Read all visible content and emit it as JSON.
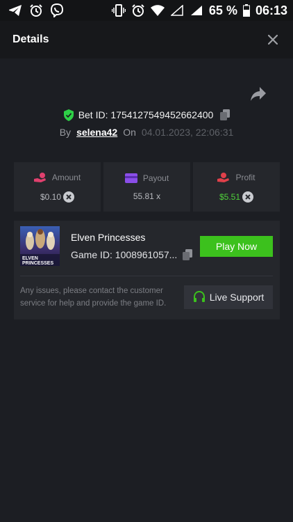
{
  "status_bar": {
    "battery_percent": "65 %",
    "time": "06:13",
    "icons": [
      "telegram-icon",
      "alarm-icon",
      "viber-icon",
      "vibrate-icon",
      "alarm-icon",
      "wifi-icon",
      "signal-icon",
      "signal-icon",
      "battery-icon"
    ]
  },
  "header": {
    "title": "Details"
  },
  "bet": {
    "id_label": "Bet ID: 1754127549452662400",
    "by_label": "By",
    "user": "selena42",
    "on_label": "On",
    "date": "04.01.2023, 22:06:31"
  },
  "stats": [
    {
      "label": "Amount",
      "value": "$0.10",
      "icon": "money-hand-icon",
      "icon_color": "#e0406e",
      "has_coin": true
    },
    {
      "label": "Payout",
      "value": "55.81 x",
      "icon": "card-icon",
      "icon_color": "#8a4ee8",
      "has_coin": false
    },
    {
      "label": "Profit",
      "value": "$5.51",
      "icon": "money-hand-icon",
      "icon_color": "#e0404a",
      "has_coin": true,
      "value_color": "#4fd13a"
    }
  ],
  "game": {
    "name": "Elven Princesses",
    "id_label": "Game ID: 1008961057...",
    "thumb_title_1": "ELVEN",
    "thumb_title_2": "PRINCESSES",
    "play_label": "Play Now",
    "support_text": "Any issues, please contact the customer service for help and provide the game ID.",
    "support_label": "Live Support"
  },
  "colors": {
    "accent_green": "#3cc11d",
    "shield_green": "#2ed047",
    "background": "#1c1e23",
    "card": "#25272c"
  }
}
